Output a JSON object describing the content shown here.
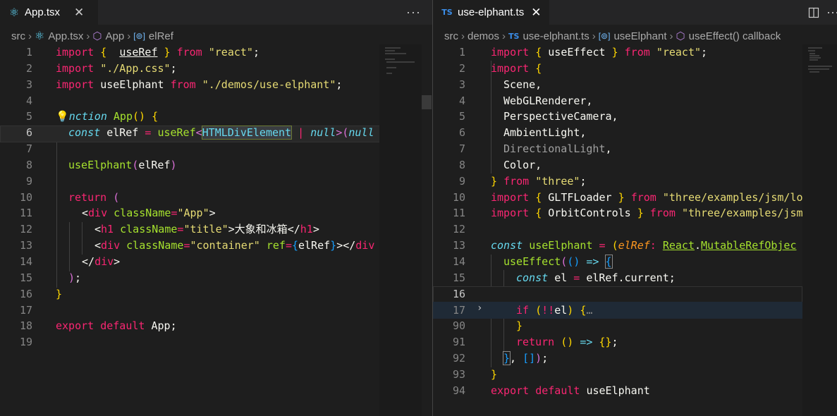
{
  "left": {
    "tab": {
      "label": "App.tsx",
      "icon": "react-icon"
    },
    "more_actions": "···",
    "breadcrumb": [
      "src",
      "App.tsx",
      "App",
      "elRef"
    ],
    "line_numbers": [
      "1",
      "2",
      "3",
      "4",
      "5",
      "6",
      "7",
      "8",
      "9",
      "10",
      "11",
      "12",
      "13",
      "14",
      "15",
      "16",
      "17",
      "18",
      "19"
    ],
    "active_line": "6"
  },
  "right": {
    "tab": {
      "label": "use-elphant.ts",
      "icon": "ts-icon",
      "icon_text": "TS"
    },
    "breadcrumb": [
      "src",
      "demos",
      "use-elphant.ts",
      "useElphant",
      "useEffect() callback"
    ],
    "line_numbers": [
      "1",
      "2",
      "3",
      "4",
      "5",
      "6",
      "7",
      "8",
      "9",
      "10",
      "11",
      "12",
      "13",
      "14",
      "15",
      "16",
      "17",
      "90",
      "91",
      "92",
      "93",
      "94"
    ],
    "active_line": "16"
  },
  "colors": {
    "editor_bg": "#1e1e1e",
    "tab_bar_bg": "#252526",
    "keyword": "#f92672",
    "function": "#a6e22e",
    "string": "#e6db74",
    "type": "#66d9ef"
  }
}
